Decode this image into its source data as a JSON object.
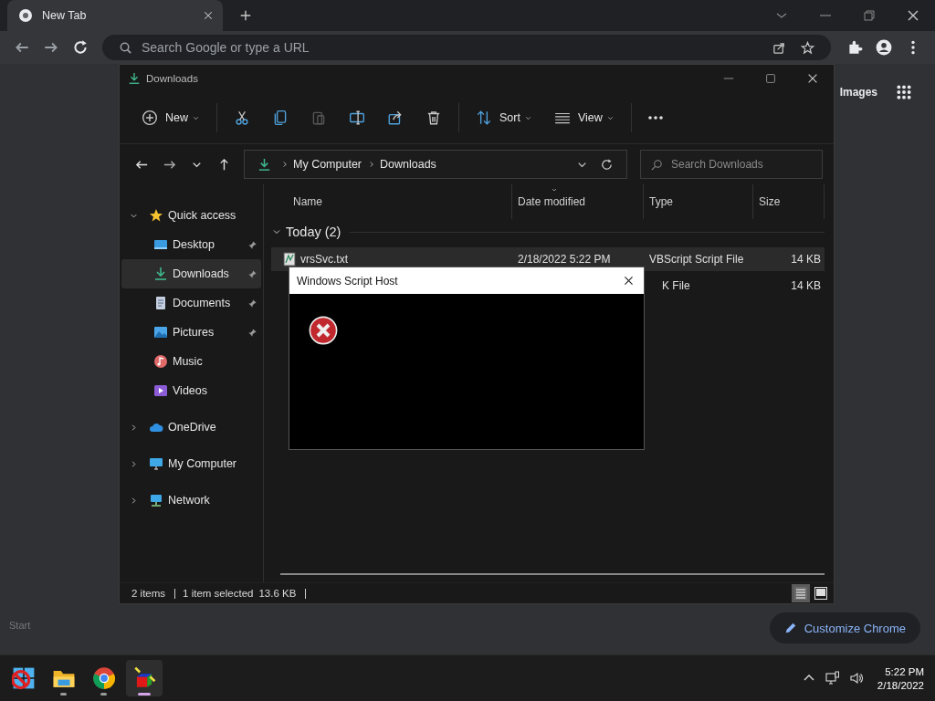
{
  "browser": {
    "tabs": [
      {
        "title": "New Tab",
        "selected": true
      }
    ],
    "address_placeholder": "Search Google or type a URL"
  },
  "new_tab_page": {
    "header_links": [
      "Images"
    ],
    "bottom_text": "Start",
    "customize_button": "Customize Chrome"
  },
  "explorer": {
    "title": "Downloads",
    "commands": [
      {
        "kind": "new",
        "label": "New",
        "disabled": false
      },
      {
        "kind": "cut",
        "disabled": false
      },
      {
        "kind": "copy",
        "disabled": false
      },
      {
        "kind": "paste",
        "disabled": true
      },
      {
        "kind": "rename",
        "disabled": false
      },
      {
        "kind": "share",
        "disabled": false
      },
      {
        "kind": "delete",
        "disabled": false
      },
      {
        "kind": "sort",
        "label": "Sort",
        "disabled": false
      },
      {
        "kind": "view",
        "label": "View",
        "disabled": false
      },
      {
        "kind": "more",
        "disabled": false
      }
    ],
    "breadcrumb": [
      "My Computer",
      "Downloads"
    ],
    "search_placeholder": "Search Downloads",
    "sidebar": [
      {
        "label": "Quick access",
        "kind": "star",
        "expanded": true,
        "selected": false,
        "children": [
          {
            "label": "Desktop",
            "kind": "desktop",
            "pinned": true,
            "selected": false
          },
          {
            "label": "Downloads",
            "kind": "download",
            "pinned": true,
            "selected": true
          },
          {
            "label": "Documents",
            "kind": "documents",
            "pinned": true,
            "selected": false
          },
          {
            "label": "Pictures",
            "kind": "pictures",
            "pinned": true,
            "selected": false
          },
          {
            "label": "Music",
            "kind": "music",
            "pinned": false,
            "selected": false
          },
          {
            "label": "Videos",
            "kind": "videos",
            "pinned": false,
            "selected": false
          }
        ]
      },
      {
        "label": "OneDrive",
        "kind": "cloud",
        "expanded": false,
        "selected": false
      },
      {
        "label": "My Computer",
        "kind": "computer",
        "expanded": false,
        "selected": false
      },
      {
        "label": "Network",
        "kind": "network",
        "expanded": false,
        "selected": false
      }
    ],
    "columns": [
      {
        "label": "Name",
        "sorted": false
      },
      {
        "label": "Date modified",
        "sorted": true
      },
      {
        "label": "Type",
        "sorted": false
      },
      {
        "label": "Size",
        "sorted": false
      }
    ],
    "group": {
      "label": "Today (2)",
      "expanded": true
    },
    "rows": [
      {
        "name": "vrsSvc.txt",
        "date": "2/18/2022 5:22 PM",
        "type": "VBScript Script File",
        "size": "14 KB",
        "selected": true
      },
      {
        "type": "K File",
        "size": "14 KB",
        "selected": false
      }
    ],
    "status": [
      "2 items",
      "1 item selected",
      "13.6 KB"
    ],
    "views": [
      {
        "kind": "details",
        "selected": true
      },
      {
        "kind": "tiles",
        "selected": false
      }
    ]
  },
  "dialog": {
    "title": "Windows Script Host",
    "kind": "error"
  },
  "taskbar": {
    "apps": [
      {
        "kind": "start",
        "running": false,
        "selected": false
      },
      {
        "kind": "files",
        "running": true,
        "selected": false
      },
      {
        "kind": "chrome",
        "running": true,
        "selected": false
      },
      {
        "kind": "script",
        "running": true,
        "selected": true
      }
    ],
    "time": "5:22 PM",
    "date": "2/18/2022"
  }
}
